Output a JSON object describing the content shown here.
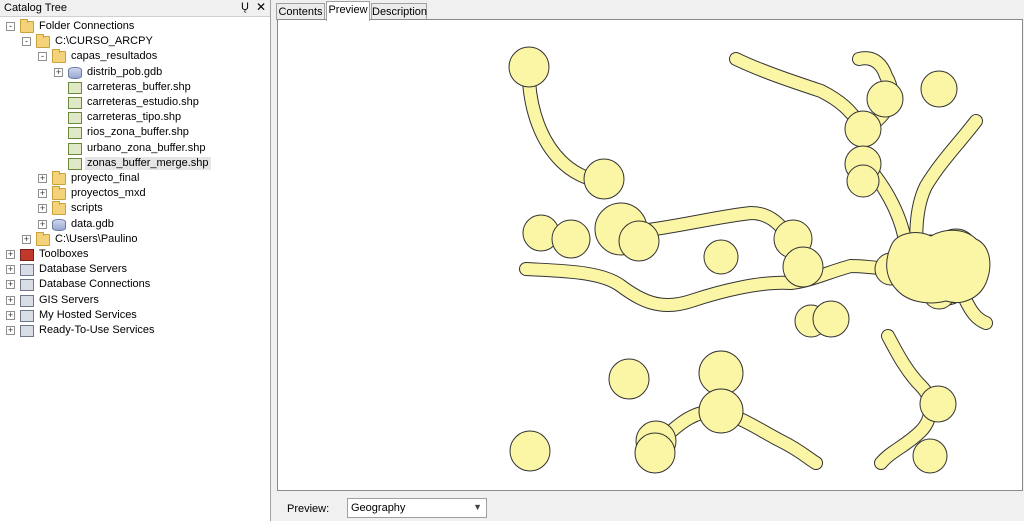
{
  "catalog": {
    "title": "Catalog Tree",
    "pin_glyph": "Ų",
    "close_glyph": "✕",
    "items": [
      {
        "label": "Folder Connections",
        "icon": "folder-connections-icon",
        "expander": "-"
      },
      {
        "label": "C:\\CURSO_ARCPY",
        "icon": "folder-icon",
        "expander": "-"
      },
      {
        "label": "capas_resultados",
        "icon": "folder-icon",
        "expander": "-"
      },
      {
        "label": "distrib_pob.gdb",
        "icon": "geodatabase-icon",
        "expander": "+"
      },
      {
        "label": "carreteras_buffer.shp",
        "icon": "polygon-shapefile-icon",
        "expander": ""
      },
      {
        "label": "carreteras_estudio.shp",
        "icon": "line-shapefile-icon",
        "expander": ""
      },
      {
        "label": "carreteras_tipo.shp",
        "icon": "polygon-shapefile-icon",
        "expander": ""
      },
      {
        "label": "rios_zona_buffer.shp",
        "icon": "polygon-shapefile-icon",
        "expander": ""
      },
      {
        "label": "urbano_zona_buffer.shp",
        "icon": "polygon-shapefile-icon",
        "expander": ""
      },
      {
        "label": "zonas_buffer_merge.shp",
        "icon": "polygon-shapefile-icon",
        "expander": "",
        "selected": true
      },
      {
        "label": "proyecto_final",
        "icon": "folder-icon",
        "expander": "+"
      },
      {
        "label": "proyectos_mxd",
        "icon": "folder-icon",
        "expander": "+"
      },
      {
        "label": "scripts",
        "icon": "folder-icon",
        "expander": "+"
      },
      {
        "label": "data.gdb",
        "icon": "geodatabase-icon",
        "expander": "+"
      },
      {
        "label": "C:\\Users\\Paulino",
        "icon": "folder-icon",
        "expander": "+"
      },
      {
        "label": "Toolboxes",
        "icon": "toolbox-icon",
        "expander": "+"
      },
      {
        "label": "Database Servers",
        "icon": "database-server-icon",
        "expander": "+"
      },
      {
        "label": "Database Connections",
        "icon": "database-connection-icon",
        "expander": "+"
      },
      {
        "label": "GIS Servers",
        "icon": "gis-server-icon",
        "expander": "+"
      },
      {
        "label": "My Hosted Services",
        "icon": "hosted-services-icon",
        "expander": "+"
      },
      {
        "label": "Ready-To-Use Services",
        "icon": "ready-services-icon",
        "expander": "+"
      }
    ]
  },
  "tabs": [
    {
      "label": "Contents",
      "active": false
    },
    {
      "label": "Preview",
      "active": true
    },
    {
      "label": "Description",
      "active": false
    }
  ],
  "preview": {
    "label": "Preview:",
    "selected_view": "Geography",
    "chevron_glyph": "▼",
    "fill_color": "#fbf5a6",
    "stroke_color": "#333333"
  }
}
